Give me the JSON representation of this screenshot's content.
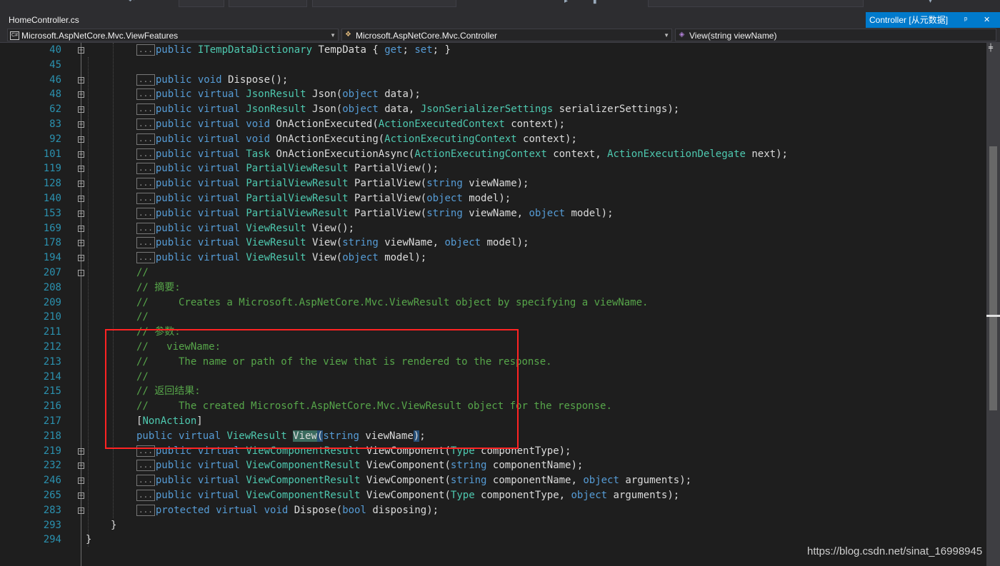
{
  "tab": {
    "file": "HomeController.cs"
  },
  "preview_tab": {
    "label": "Controller [从元数据]",
    "pin": "ᵖ",
    "close": "✕"
  },
  "nav": {
    "project": "Microsoft.AspNetCore.Mvc.ViewFeatures",
    "type": "Microsoft.AspNetCore.Mvc.Controller",
    "member": "View(string viewName)"
  },
  "watermark": "https://blog.csdn.net/sinat_16998945",
  "lines": [
    {
      "n": "40",
      "fold": "+",
      "c": true,
      "t": [
        [
          "kw",
          "public "
        ],
        [
          "ty",
          "ITempDataDictionary"
        ],
        [
          "pl",
          " TempData { "
        ],
        [
          "kw",
          "get"
        ],
        [
          "pl",
          "; "
        ],
        [
          "kw",
          "set"
        ],
        [
          "pl",
          "; }"
        ]
      ]
    },
    {
      "n": "45",
      "fold": "",
      "c": false,
      "t": []
    },
    {
      "n": "46",
      "fold": "+",
      "c": true,
      "t": [
        [
          "kw",
          "public void "
        ],
        [
          "pl",
          "Dispose();"
        ]
      ]
    },
    {
      "n": "48",
      "fold": "+",
      "c": true,
      "t": [
        [
          "kw",
          "public virtual "
        ],
        [
          "ty",
          "JsonResult"
        ],
        [
          "pl",
          " Json("
        ],
        [
          "kw",
          "object"
        ],
        [
          "pl",
          " data);"
        ]
      ]
    },
    {
      "n": "62",
      "fold": "+",
      "c": true,
      "t": [
        [
          "kw",
          "public virtual "
        ],
        [
          "ty",
          "JsonResult"
        ],
        [
          "pl",
          " Json("
        ],
        [
          "kw",
          "object"
        ],
        [
          "pl",
          " data, "
        ],
        [
          "ty",
          "JsonSerializerSettings"
        ],
        [
          "pl",
          " serializerSettings);"
        ]
      ]
    },
    {
      "n": "83",
      "fold": "+",
      "c": true,
      "t": [
        [
          "kw",
          "public virtual void "
        ],
        [
          "pl",
          "OnActionExecuted("
        ],
        [
          "ty",
          "ActionExecutedContext"
        ],
        [
          "pl",
          " context);"
        ]
      ]
    },
    {
      "n": "92",
      "fold": "+",
      "c": true,
      "t": [
        [
          "kw",
          "public virtual void "
        ],
        [
          "pl",
          "OnActionExecuting("
        ],
        [
          "ty",
          "ActionExecutingContext"
        ],
        [
          "pl",
          " context);"
        ]
      ]
    },
    {
      "n": "101",
      "fold": "+",
      "c": true,
      "t": [
        [
          "kw",
          "public virtual "
        ],
        [
          "ty",
          "Task"
        ],
        [
          "pl",
          " OnActionExecutionAsync("
        ],
        [
          "ty",
          "ActionExecutingContext"
        ],
        [
          "pl",
          " context, "
        ],
        [
          "ty",
          "ActionExecutionDelegate"
        ],
        [
          "pl",
          " next);"
        ]
      ]
    },
    {
      "n": "119",
      "fold": "+",
      "c": true,
      "t": [
        [
          "kw",
          "public virtual "
        ],
        [
          "ty",
          "PartialViewResult"
        ],
        [
          "pl",
          " PartialView();"
        ]
      ]
    },
    {
      "n": "128",
      "fold": "+",
      "c": true,
      "t": [
        [
          "kw",
          "public virtual "
        ],
        [
          "ty",
          "PartialViewResult"
        ],
        [
          "pl",
          " PartialView("
        ],
        [
          "kw",
          "string"
        ],
        [
          "pl",
          " viewName);"
        ]
      ]
    },
    {
      "n": "140",
      "fold": "+",
      "c": true,
      "t": [
        [
          "kw",
          "public virtual "
        ],
        [
          "ty",
          "PartialViewResult"
        ],
        [
          "pl",
          " PartialView("
        ],
        [
          "kw",
          "object"
        ],
        [
          "pl",
          " model);"
        ]
      ]
    },
    {
      "n": "153",
      "fold": "+",
      "c": true,
      "t": [
        [
          "kw",
          "public virtual "
        ],
        [
          "ty",
          "PartialViewResult"
        ],
        [
          "pl",
          " PartialView("
        ],
        [
          "kw",
          "string"
        ],
        [
          "pl",
          " viewName, "
        ],
        [
          "kw",
          "object"
        ],
        [
          "pl",
          " model);"
        ]
      ]
    },
    {
      "n": "169",
      "fold": "+",
      "c": true,
      "t": [
        [
          "kw",
          "public virtual "
        ],
        [
          "ty",
          "ViewResult"
        ],
        [
          "pl",
          " View();"
        ]
      ]
    },
    {
      "n": "178",
      "fold": "+",
      "c": true,
      "t": [
        [
          "kw",
          "public virtual "
        ],
        [
          "ty",
          "ViewResult"
        ],
        [
          "pl",
          " View("
        ],
        [
          "kw",
          "string"
        ],
        [
          "pl",
          " viewName, "
        ],
        [
          "kw",
          "object"
        ],
        [
          "pl",
          " model);"
        ]
      ]
    },
    {
      "n": "194",
      "fold": "+",
      "c": true,
      "t": [
        [
          "kw",
          "public virtual "
        ],
        [
          "ty",
          "ViewResult"
        ],
        [
          "pl",
          " View("
        ],
        [
          "kw",
          "object"
        ],
        [
          "pl",
          " model);"
        ]
      ]
    },
    {
      "n": "207",
      "fold": "-",
      "c": false,
      "t": [
        [
          "cm",
          "//"
        ]
      ]
    },
    {
      "n": "208",
      "fold": "",
      "c": false,
      "t": [
        [
          "cm",
          "// 摘要:"
        ]
      ]
    },
    {
      "n": "209",
      "fold": "",
      "c": false,
      "t": [
        [
          "cm",
          "//     Creates a Microsoft.AspNetCore.Mvc.ViewResult object by specifying a viewName."
        ]
      ]
    },
    {
      "n": "210",
      "fold": "",
      "c": false,
      "t": [
        [
          "cm",
          "//"
        ]
      ]
    },
    {
      "n": "211",
      "fold": "",
      "c": false,
      "t": [
        [
          "cm",
          "// 参数:"
        ]
      ]
    },
    {
      "n": "212",
      "fold": "",
      "c": false,
      "t": [
        [
          "cm",
          "//   viewName:"
        ]
      ]
    },
    {
      "n": "213",
      "fold": "",
      "c": false,
      "t": [
        [
          "cm",
          "//     The name or path of the view that is rendered to the response."
        ]
      ]
    },
    {
      "n": "214",
      "fold": "",
      "c": false,
      "t": [
        [
          "cm",
          "//"
        ]
      ]
    },
    {
      "n": "215",
      "fold": "",
      "c": false,
      "t": [
        [
          "cm",
          "// 返回结果:"
        ]
      ]
    },
    {
      "n": "216",
      "fold": "",
      "c": false,
      "t": [
        [
          "cm",
          "//     The created Microsoft.AspNetCore.Mvc.ViewResult object for the response."
        ]
      ]
    },
    {
      "n": "217",
      "fold": "",
      "c": false,
      "t": [
        [
          "pl",
          "["
        ],
        [
          "ty",
          "NonAction"
        ],
        [
          "pl",
          "]"
        ]
      ]
    },
    {
      "n": "218",
      "fold": "",
      "c": false,
      "t": [
        [
          "kw",
          "public virtual "
        ],
        [
          "ty",
          "ViewResult"
        ],
        [
          "pl",
          " "
        ],
        [
          "hlv",
          "View"
        ],
        [
          "hl",
          "("
        ],
        [
          "kw",
          "string"
        ],
        [
          "pl",
          " viewName"
        ],
        [
          "hl",
          ")"
        ],
        [
          "pl",
          ";"
        ]
      ]
    },
    {
      "n": "219",
      "fold": "+",
      "c": true,
      "t": [
        [
          "kw",
          "public virtual "
        ],
        [
          "ty",
          "ViewComponentResult"
        ],
        [
          "pl",
          " ViewComponent("
        ],
        [
          "ty",
          "Type"
        ],
        [
          "pl",
          " componentType);"
        ]
      ]
    },
    {
      "n": "232",
      "fold": "+",
      "c": true,
      "t": [
        [
          "kw",
          "public virtual "
        ],
        [
          "ty",
          "ViewComponentResult"
        ],
        [
          "pl",
          " ViewComponent("
        ],
        [
          "kw",
          "string"
        ],
        [
          "pl",
          " componentName);"
        ]
      ]
    },
    {
      "n": "246",
      "fold": "+",
      "c": true,
      "t": [
        [
          "kw",
          "public virtual "
        ],
        [
          "ty",
          "ViewComponentResult"
        ],
        [
          "pl",
          " ViewComponent("
        ],
        [
          "kw",
          "string"
        ],
        [
          "pl",
          " componentName, "
        ],
        [
          "kw",
          "object"
        ],
        [
          "pl",
          " arguments);"
        ]
      ]
    },
    {
      "n": "265",
      "fold": "+",
      "c": true,
      "t": [
        [
          "kw",
          "public virtual "
        ],
        [
          "ty",
          "ViewComponentResult"
        ],
        [
          "pl",
          " ViewComponent("
        ],
        [
          "ty",
          "Type"
        ],
        [
          "pl",
          " componentType, "
        ],
        [
          "kw",
          "object"
        ],
        [
          "pl",
          " arguments);"
        ]
      ]
    },
    {
      "n": "283",
      "fold": "+",
      "c": true,
      "t": [
        [
          "kw",
          "protected virtual void "
        ],
        [
          "pl",
          "Dispose("
        ],
        [
          "kw",
          "bool"
        ],
        [
          "pl",
          " disposing);"
        ]
      ]
    },
    {
      "n": "293",
      "fold": "",
      "c": false,
      "close": true,
      "t": [
        [
          "pl",
          "}"
        ]
      ]
    },
    {
      "n": "294",
      "fold": "",
      "c": false,
      "brace": true,
      "t": [
        [
          "pl",
          "}"
        ]
      ]
    }
  ],
  "collapsed_marker": "..."
}
